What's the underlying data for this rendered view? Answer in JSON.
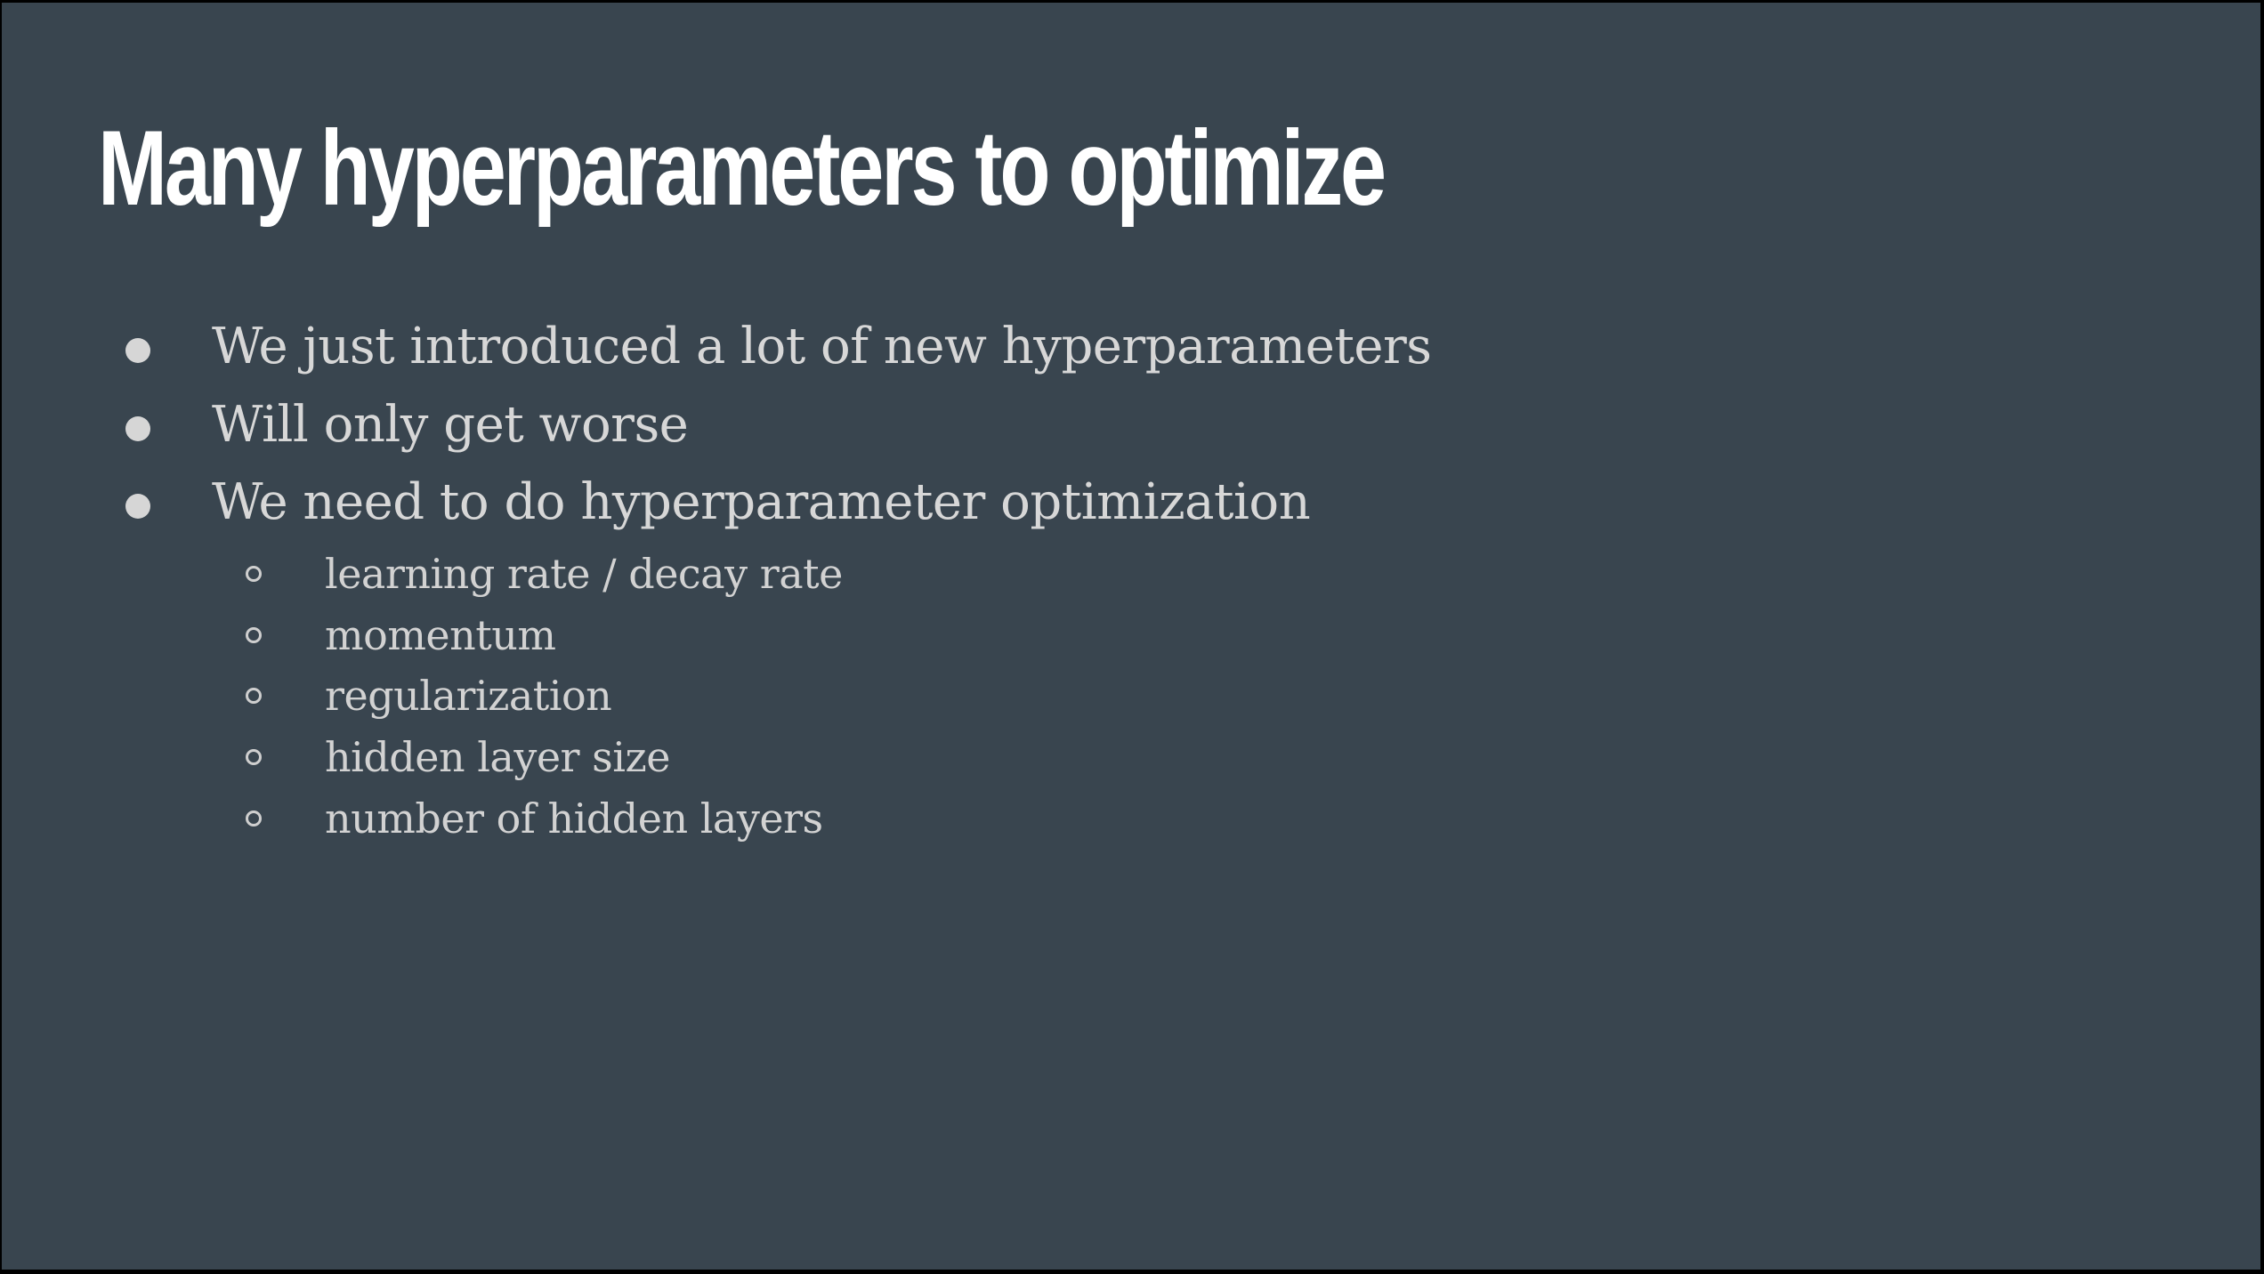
{
  "slide": {
    "title": "Many hyperparameters to optimize",
    "bullets": [
      {
        "text": "We just introduced a lot of new hyperparameters"
      },
      {
        "text": "Will only get worse"
      },
      {
        "text": "We need to do hyperparameter optimization"
      }
    ],
    "sub_bullets": [
      {
        "text": "learning rate / decay rate"
      },
      {
        "text": "momentum"
      },
      {
        "text": "regularization"
      },
      {
        "text": "hidden layer size"
      },
      {
        "text": "number of hidden layers"
      }
    ]
  },
  "colors": {
    "background": "#39454f",
    "title": "#ffffff",
    "body_text": "#d7d7d7"
  }
}
